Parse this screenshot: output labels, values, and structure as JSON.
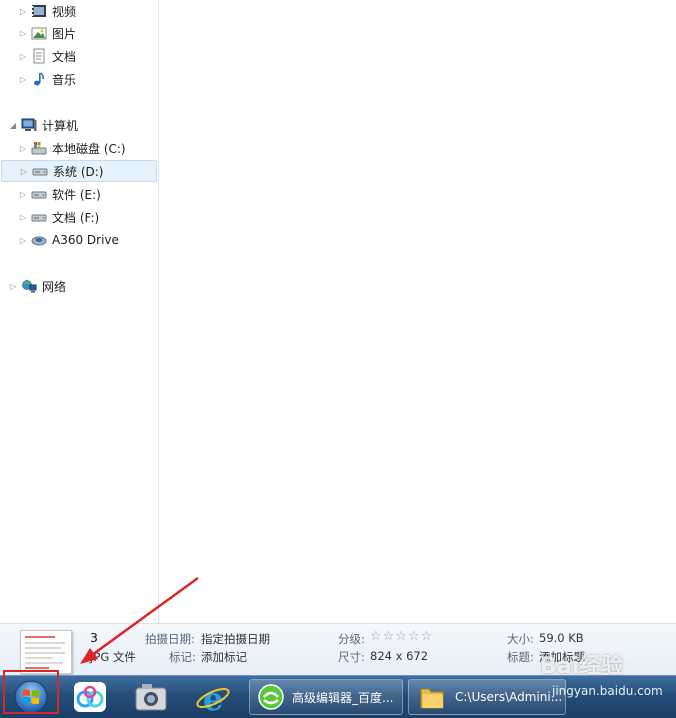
{
  "nav": {
    "items": [
      {
        "label": "视频",
        "icon": "video-library-icon"
      },
      {
        "label": "图片",
        "icon": "pictures-library-icon"
      },
      {
        "label": "文档",
        "icon": "documents-library-icon"
      },
      {
        "label": "音乐",
        "icon": "music-library-icon"
      },
      {
        "label": "计算机",
        "icon": "computer-icon"
      },
      {
        "label": "本地磁盘 (C:)",
        "icon": "system-drive-icon"
      },
      {
        "label": "系统 (D:)",
        "icon": "drive-icon"
      },
      {
        "label": "软件 (E:)",
        "icon": "drive-icon"
      },
      {
        "label": "文档 (F:)",
        "icon": "drive-icon"
      },
      {
        "label": "A360 Drive",
        "icon": "cloud-drive-icon"
      },
      {
        "label": "网络",
        "icon": "network-icon"
      }
    ],
    "selected": "系统 (D:)"
  },
  "details": {
    "file_name": "3",
    "file_type": "JPG 文件",
    "date_taken_label": "拍摄日期:",
    "date_taken_value": "指定拍摄日期",
    "tags_label": "标记:",
    "tags_value": "添加标记",
    "rating_label": "分级:",
    "rating_stars": "☆☆☆☆☆",
    "rating_value": 0,
    "dimensions_label": "尺寸:",
    "dimensions_value": "824 x 672",
    "size_label": "大小:",
    "size_value": "59.0 KB",
    "title_label": "标题:",
    "title_value": "添加标题"
  },
  "taskbar": {
    "start_icon": "windows-start-orb-icon",
    "pinned": [
      "baidu-netdisk-icon",
      "camera-app-icon",
      "internet-explorer-icon"
    ],
    "windows": [
      {
        "label": "高级编辑器_百度...",
        "icon": "browser-icon"
      },
      {
        "label": "C:\\Users\\Admini...",
        "icon": "folder-icon"
      }
    ]
  },
  "watermark": {
    "text": "Bai经验",
    "url": "jingyan.baidu.com"
  },
  "colors": {
    "annotation_red": "#d9262b",
    "taskbar_blue": "#244e79",
    "selection": "#e5f1fb"
  }
}
